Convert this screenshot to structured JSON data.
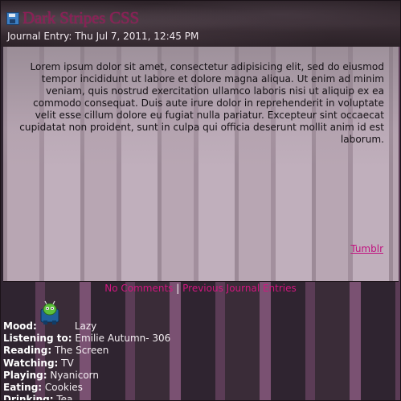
{
  "header": {
    "title": "Dark Stripes CSS",
    "entry_date": "Journal Entry: Thu Jul 7, 2011, 12:45 PM",
    "icon": "save-icon"
  },
  "content": {
    "body": "Lorem ipsum dolor sit amet, consectetur adipisicing elit, sed do eiusmod tempor incididunt ut labore et dolore magna aliqua. Ut enim ad minim veniam, quis nostrud exercitation ullamco laboris nisi ut aliquip ex ea commodo consequat. Duis aute irure dolor in reprehenderit in voluptate velit esse cillum dolore eu fugiat nulla pariatur. Excepteur sint occaecat cupidatat non proident, sunt in culpa qui officia deserunt mollit anim id est laborum.",
    "tumblr_link": "Tumblr"
  },
  "footer": {
    "comments_link": "No Comments",
    "separator": "|",
    "previous_link": "Previous Journal Entries"
  },
  "meta": {
    "mood_icon": "lazy-mood-icon",
    "mood_label": "Mood:",
    "mood_value": "Lazy",
    "listening_label": "Listening to:",
    "listening_value": "Emilie Autumn- 306",
    "reading_label": "Reading:",
    "reading_value": "The Screen",
    "watching_label": "Watching:",
    "watching_value": "TV",
    "playing_label": "Playing:",
    "playing_value": "Nyanicorn",
    "eating_label": "Eating:",
    "eating_value": "Cookies",
    "drinking_label": "Drinking:",
    "drinking_value": "Tea"
  },
  "colors": {
    "title": "#8a1e55",
    "link": "#c0107e",
    "text_dark": "#141014",
    "text_light": "#f4eef2"
  }
}
